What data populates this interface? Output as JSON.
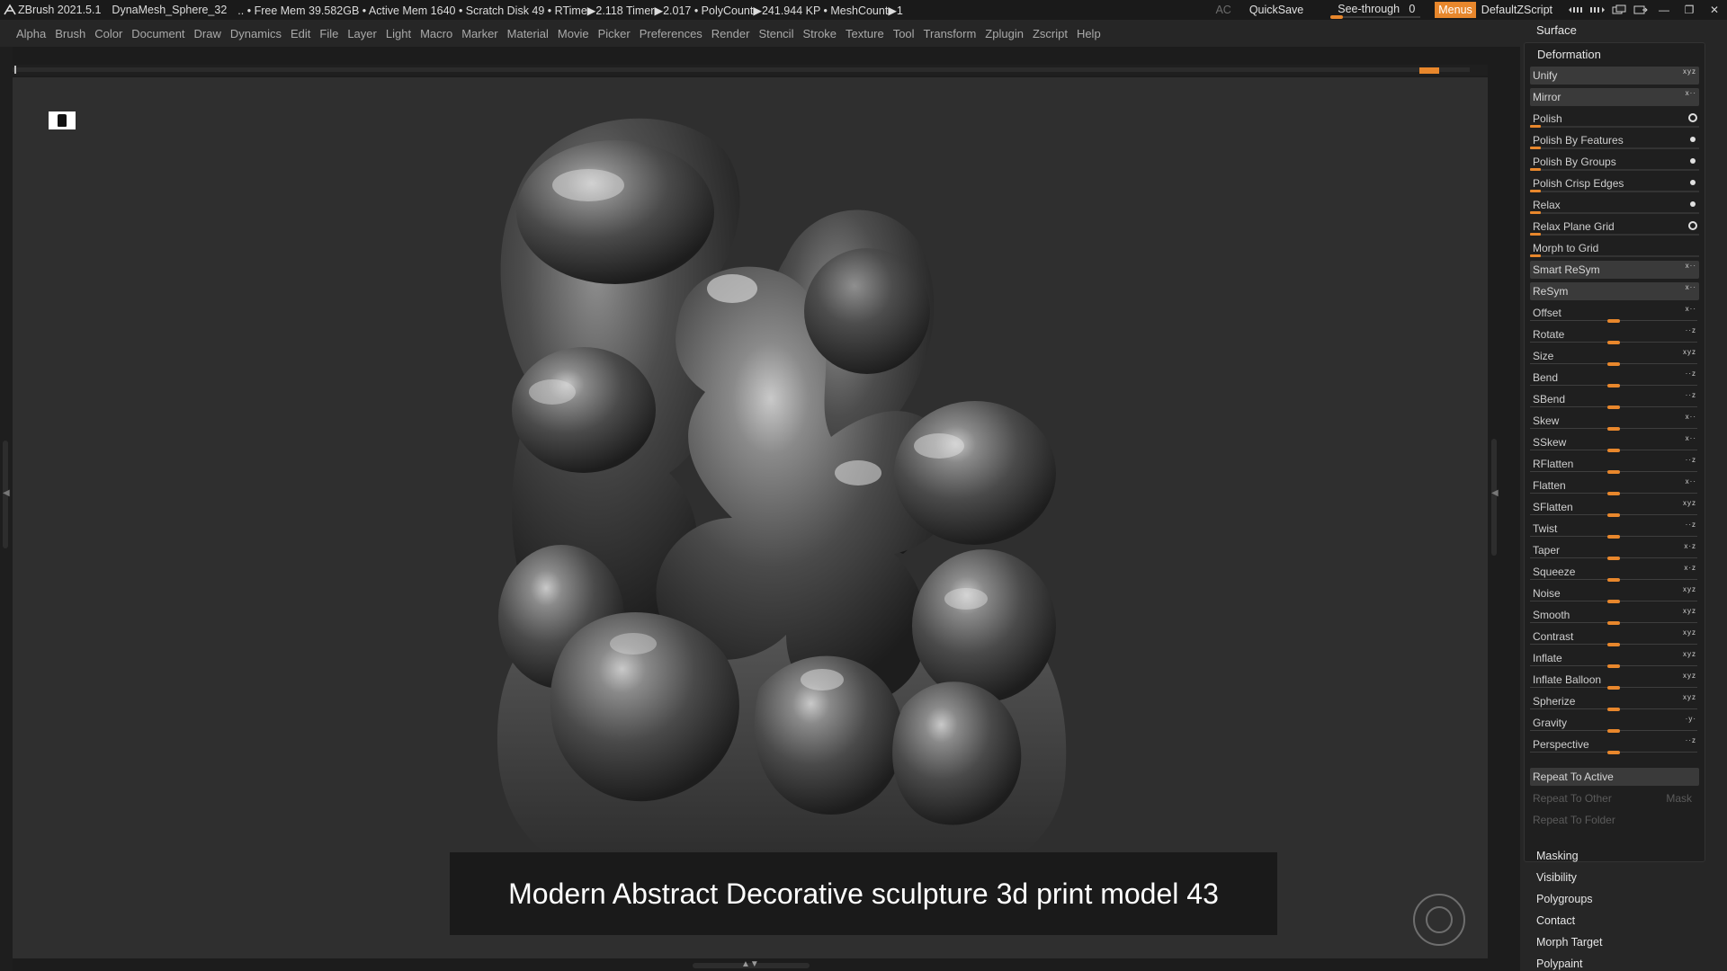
{
  "titlebar": {
    "app": "ZBrush 2021.5.1",
    "file": "DynaMesh_Sphere_32",
    "status": ".. • Free Mem 39.582GB • Active Mem 1640 • Scratch Disk 49 • RTime▶2.118 Timer▶2.017 • PolyCount▶241.944 KP • MeshCount▶1",
    "ac": "AC",
    "quicksave": "QuickSave",
    "seethrough_label": "See-through",
    "seethrough_value": "0",
    "seethrough_level": 0,
    "menus": "Menus",
    "default_zscript": "DefaultZScript"
  },
  "menus": [
    "Alpha",
    "Brush",
    "Color",
    "Document",
    "Draw",
    "Dynamics",
    "Edit",
    "File",
    "Layer",
    "Light",
    "Macro",
    "Marker",
    "Material",
    "Movie",
    "Picker",
    "Preferences",
    "Render",
    "Stencil",
    "Stroke",
    "Texture",
    "Tool",
    "Transform",
    "Zplugin",
    "Zscript",
    "Help"
  ],
  "caption": "Modern Abstract Decorative sculpture 3d print model 43",
  "panel": {
    "surface": "Surface",
    "deformation": "Deformation",
    "top_rows": [
      {
        "label": "Unify",
        "kind": "button",
        "axes": "xyz"
      },
      {
        "label": "Mirror",
        "kind": "button",
        "axes": "x"
      },
      {
        "label": "Polish",
        "kind": "polish",
        "indicator": "ring"
      },
      {
        "label": "Polish By Features",
        "kind": "polish",
        "indicator": "dot"
      },
      {
        "label": "Polish By Groups",
        "kind": "polish",
        "indicator": "dot"
      },
      {
        "label": "Polish Crisp Edges",
        "kind": "polish",
        "indicator": "dot"
      },
      {
        "label": "Relax",
        "kind": "polish",
        "indicator": "dot"
      },
      {
        "label": "Relax Plane Grid",
        "kind": "polish",
        "indicator": "ring"
      },
      {
        "label": "Morph to Grid",
        "kind": "polish",
        "indicator": ""
      },
      {
        "label": "Smart ReSym",
        "kind": "button",
        "axes": "x"
      },
      {
        "label": "ReSym",
        "kind": "button",
        "axes": "x"
      }
    ],
    "sliders": [
      {
        "label": "Offset",
        "axes": "x"
      },
      {
        "label": "Rotate",
        "axes": "z"
      },
      {
        "label": "Size",
        "axes": "xyz"
      },
      {
        "label": "Bend",
        "axes": "z"
      },
      {
        "label": "SBend",
        "axes": "z"
      },
      {
        "label": "Skew",
        "axes": "x"
      },
      {
        "label": "SSkew",
        "axes": "x"
      },
      {
        "label": "RFlatten",
        "axes": "z"
      },
      {
        "label": "Flatten",
        "axes": "x"
      },
      {
        "label": "SFlatten",
        "axes": "xyz"
      },
      {
        "label": "Twist",
        "axes": "z"
      },
      {
        "label": "Taper",
        "axes": "xz"
      },
      {
        "label": "Squeeze",
        "axes": "xz"
      },
      {
        "label": "Noise",
        "axes": "xyz"
      },
      {
        "label": "Smooth",
        "axes": "xyz"
      },
      {
        "label": "Contrast",
        "axes": "xyz"
      },
      {
        "label": "Inflate",
        "axes": "xyz"
      },
      {
        "label": "Inflate Balloon",
        "axes": "xyz"
      },
      {
        "label": "Spherize",
        "axes": "xyz"
      },
      {
        "label": "Gravity",
        "axes": "y"
      },
      {
        "label": "Perspective",
        "axes": "z"
      }
    ],
    "repeat_active": "Repeat To Active",
    "repeat_other": "Repeat To Other",
    "mask": "Mask",
    "repeat_folder": "Repeat To Folder",
    "sections": [
      "Masking",
      "Visibility",
      "Polygroups",
      "Contact",
      "Morph Target",
      "Polypaint"
    ]
  },
  "colors": {
    "accent": "#e8872c",
    "bg": "#2f2f2f",
    "panel": "#262626"
  }
}
